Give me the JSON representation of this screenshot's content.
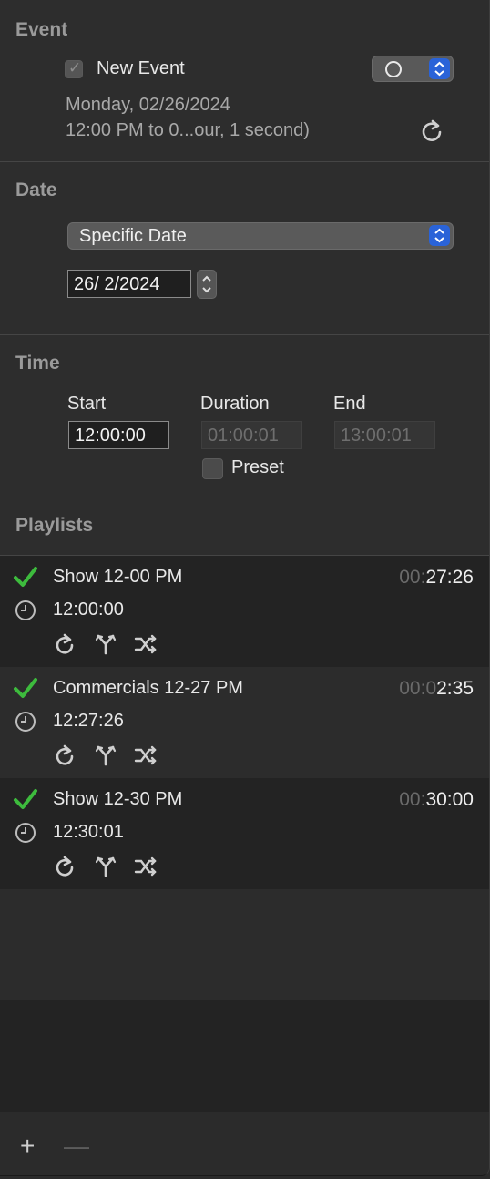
{
  "event": {
    "section_title": "Event",
    "name_checkbox_label": "New Event",
    "date_line": "Monday, 02/26/2024",
    "time_line": "12:00 PM to 0...our, 1 second)"
  },
  "date": {
    "section_title": "Date",
    "mode_value": "Specific Date",
    "date_value": "26/  2/2024"
  },
  "time": {
    "section_title": "Time",
    "start_label": "Start",
    "duration_label": "Duration",
    "end_label": "End",
    "start_value": "12:00:00",
    "duration_value": "01:00:01",
    "end_value": "13:00:01",
    "preset_label": "Preset"
  },
  "playlists": {
    "section_title": "Playlists",
    "items": [
      {
        "name": "Show 12-00 PM",
        "start": "12:00:00",
        "dur_dim": "00:",
        "dur_main": "27:26"
      },
      {
        "name": "Commercials 12-27 PM",
        "start": "12:27:26",
        "dur_dim": "00:0",
        "dur_main": "2:35"
      },
      {
        "name": "Show 12-30 PM",
        "start": "12:30:01",
        "dur_dim": "00:",
        "dur_main": "30:00"
      }
    ]
  },
  "toolbar": {
    "add_label": "+",
    "remove_label": "—"
  },
  "colors": {
    "accent_blue": "#2a63d8",
    "check_green": "#3dbb3d",
    "panel_bg": "#2d2d2d"
  }
}
